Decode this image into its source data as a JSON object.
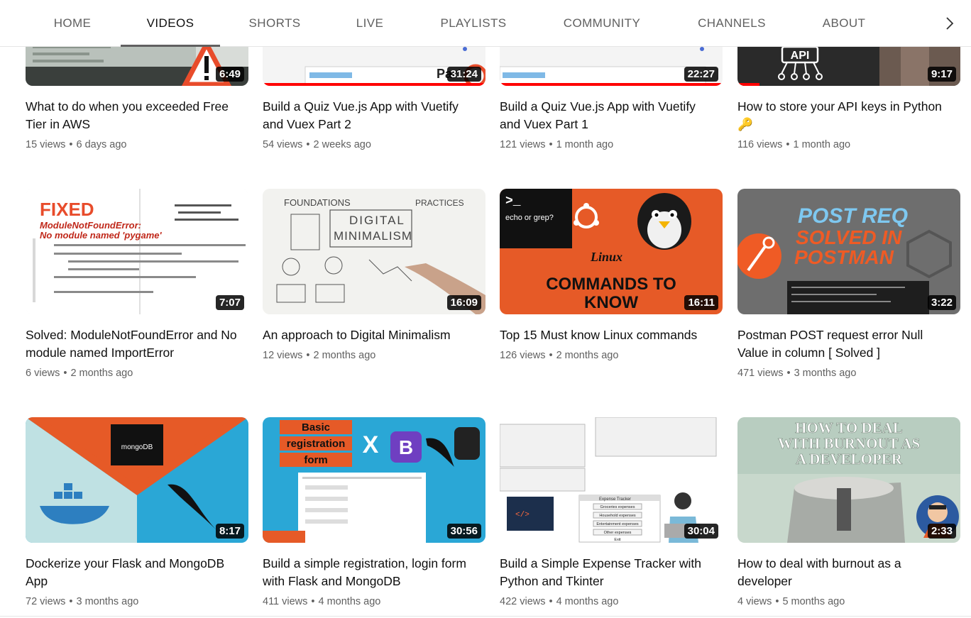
{
  "tabs": [
    {
      "label": "HOME",
      "active": false
    },
    {
      "label": "VIDEOS",
      "active": true
    },
    {
      "label": "SHORTS",
      "active": false
    },
    {
      "label": "LIVE",
      "active": false
    },
    {
      "label": "PLAYLISTS",
      "active": false
    },
    {
      "label": "COMMUNITY",
      "active": false
    },
    {
      "label": "CHANNELS",
      "active": false
    },
    {
      "label": "ABOUT",
      "active": false
    }
  ],
  "next_icon": "chevron-right-icon",
  "videos": [
    {
      "title": "What to do when you exceeded Free Tier in AWS",
      "views": "15 views",
      "age": "6 days ago",
      "duration": "6:49",
      "thumb_text": []
    },
    {
      "title": "Build a Quiz Vue.js App with Vuetify and Vuex Part 2",
      "views": "54 views",
      "age": "2 weeks ago",
      "duration": "31:24",
      "thumb_text": [
        "Part"
      ]
    },
    {
      "title": "Build a Quiz Vue.js App with Vuetify and Vuex Part 1",
      "views": "121 views",
      "age": "1 month ago",
      "duration": "22:27",
      "thumb_text": []
    },
    {
      "title": "How to store your API keys in Python 🔑",
      "views": "116 views",
      "age": "1 month ago",
      "duration": "9:17",
      "thumb_text": [
        "API"
      ]
    },
    {
      "title": "Solved: ModuleNotFoundError and No module named ImportError",
      "views": "6 views",
      "age": "2 months ago",
      "duration": "7:07",
      "thumb_text": [
        "FIXED",
        "ModuleNotFoundError:",
        "No module named 'pygame'"
      ]
    },
    {
      "title": "An approach to Digital Minimalism",
      "views": "12 views",
      "age": "2 months ago",
      "duration": "16:09",
      "thumb_text": [
        "FOUNDATIONS",
        "DIGITAL",
        "MINIMALISM",
        "PRACTICES"
      ]
    },
    {
      "title": "Top 15 Must know Linux commands",
      "views": "126 views",
      "age": "2 months ago",
      "duration": "16:11",
      "thumb_text": [
        "echo or grep?",
        "Linux",
        "COMMANDS TO",
        "KNOW"
      ]
    },
    {
      "title": "Postman POST request error Null Value in column [ Solved ]",
      "views": "471 views",
      "age": "3 months ago",
      "duration": "3:22",
      "thumb_text": [
        "POST REQ",
        "SOLVED IN",
        "POSTMAN"
      ]
    },
    {
      "title": "Dockerize your Flask and MongoDB App",
      "views": "72 views",
      "age": "3 months ago",
      "duration": "8:17",
      "thumb_text": [
        "mongoDB"
      ]
    },
    {
      "title": "Build a simple registration, login form with Flask and MongoDB",
      "views": "411 views",
      "age": "4 months ago",
      "duration": "30:56",
      "thumb_text": [
        "Basic",
        "registration",
        "form",
        "B"
      ]
    },
    {
      "title": "Build a Simple Expense Tracker with Python and Tkinter",
      "views": "422 views",
      "age": "4 months ago",
      "duration": "30:04",
      "thumb_text": [
        "Expense Tracker",
        "Groceries expenses",
        "Household expenses",
        "Entertainment expenses",
        "Other expenses",
        "Exit"
      ]
    },
    {
      "title": "How to deal with burnout as a developer",
      "views": "4 views",
      "age": "5 months ago",
      "duration": "2:33",
      "thumb_text": [
        "HOW TO DEAL",
        "WITH BURNOUT AS",
        "A DEVELOPER"
      ]
    }
  ],
  "colors": {
    "progress": "#ff0000",
    "tab_text": "#606060",
    "meta_text": "#606060"
  }
}
